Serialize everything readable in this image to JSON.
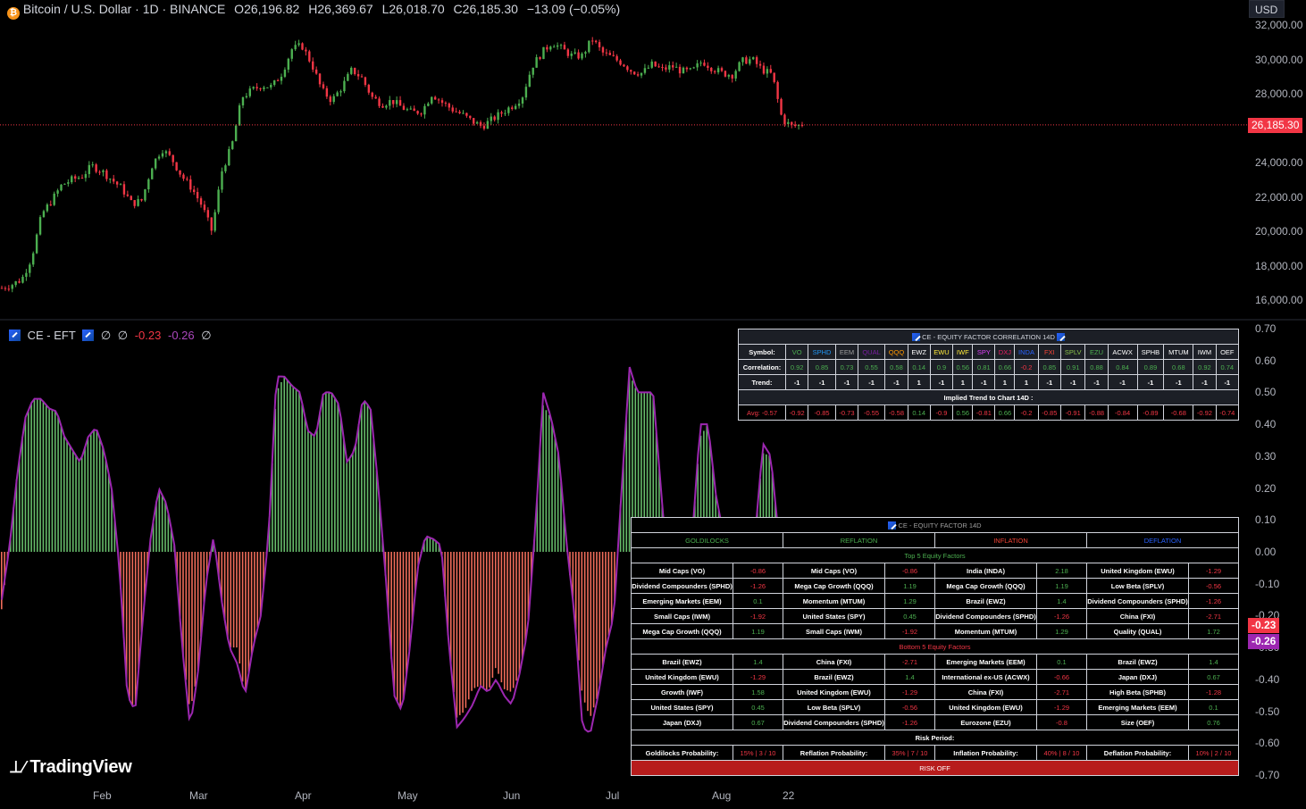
{
  "header": {
    "symbol": "Bitcoin / U.S. Dollar · 1D · BINANCE",
    "o_label": "O",
    "o_value": "26,196.82",
    "h_label": "H",
    "h_value": "26,369.67",
    "l_label": "L",
    "l_value": "26,018.70",
    "c_label": "C",
    "c_value": "26,185.30",
    "change": "−13.09 (−0.05%)"
  },
  "currency_button": "USD",
  "price_axis": [
    "32,000.00",
    "30,000.00",
    "28,000.00",
    "26,185.30",
    "24,000.00",
    "22,000.00",
    "20,000.00",
    "18,000.00",
    "16,000.00"
  ],
  "price_axis_values": [
    32000,
    30000,
    28000,
    26185.3,
    24000,
    22000,
    20000,
    18000,
    16000
  ],
  "last_price_tag": "26,185.30",
  "indicator": {
    "name": "CE - EFT",
    "v1": "∅",
    "v2": "∅",
    "v3": "-0.23",
    "v4": "-0.26",
    "v5": "∅",
    "tag_red": "-0.23",
    "tag_purple": "-0.26"
  },
  "osc_axis": [
    "0.70",
    "0.60",
    "0.50",
    "0.40",
    "0.30",
    "0.20",
    "0.10",
    "0.00",
    "-0.10",
    "-0.20",
    "-0.30",
    "-0.40",
    "-0.50",
    "-0.60",
    "-0.70"
  ],
  "osc_axis_values": [
    0.7,
    0.6,
    0.5,
    0.4,
    0.3,
    0.2,
    0.1,
    0,
    -0.1,
    -0.2,
    -0.3,
    -0.4,
    -0.5,
    -0.6,
    -0.7
  ],
  "x_axis": [
    "Feb",
    "Mar",
    "Apr",
    "May",
    "Jun",
    "Jul",
    "Aug",
    "22"
  ],
  "brand": "TradingView",
  "colors": {
    "up": "#4caf50",
    "down": "#f23645",
    "oscUp": "#66bb6a",
    "oscDown": "#ef6c5a",
    "line": "#9c27b0",
    "lastPrice": "#f23645"
  },
  "corr_table": {
    "title": "CE - EQUITY FACTOR CORRELATION 14D",
    "symbol_label": "Symbol:",
    "symbols": [
      "VO",
      "SPHD",
      "EEM",
      "QUAL",
      "QQQ",
      "EWZ",
      "EWU",
      "IWF",
      "SPY",
      "DXJ",
      "INDA",
      "FXI",
      "SPLV",
      "EZU",
      "ACWX",
      "SPHB",
      "MTUM",
      "IWM",
      "OEF"
    ],
    "symbol_colors": [
      "#4caf50",
      "#2196f3",
      "#9e9e9e",
      "#7b1fa2",
      "#ff9800",
      "#ffffff",
      "#ffeb3b",
      "#ffeb3b",
      "#e040fb",
      "#e91e63",
      "#2962ff",
      "#f44336",
      "#8bc34a",
      "#4caf50",
      "#ffffff",
      "#ffffff",
      "#ffffff",
      "#ffffff",
      "#ffffff"
    ],
    "corr_label": "Correlation:",
    "correlations": [
      "0.92",
      "0.85",
      "0.73",
      "0.55",
      "0.58",
      "0.14",
      "0.9",
      "0.56",
      "0.81",
      "0.66",
      "-0.2",
      "0.85",
      "0.91",
      "0.88",
      "0.84",
      "0.89",
      "0.68",
      "0.92",
      "0.74"
    ],
    "trend_label": "Trend:",
    "trends": [
      "-1",
      "-1",
      "-1",
      "-1",
      "-1",
      "1",
      "-1",
      "1",
      "-1",
      "1",
      "1",
      "-1",
      "-1",
      "-1",
      "-1",
      "-1",
      "-1",
      "-1",
      "-1"
    ],
    "implied_label": "Implied Trend to Chart 14D :",
    "avg_label": "Avg: -0.57",
    "implied": [
      "-0.92",
      "-0.85",
      "-0.73",
      "-0.55",
      "-0.58",
      "0.14",
      "-0.9",
      "0.56",
      "-0.81",
      "0.66",
      "-0.2",
      "-0.85",
      "-0.91",
      "-0.88",
      "-0.84",
      "-0.89",
      "-0.68",
      "-0.92",
      "-0.74"
    ]
  },
  "eq_table": {
    "title": "CE - EQUITY FACTOR 14D",
    "regimes": [
      "GOLDILOCKS",
      "REFLATION",
      "INFLATION",
      "DEFLATION"
    ],
    "regime_colors": [
      "#4caf50",
      "#4caf50",
      "#f44336",
      "#2962ff"
    ],
    "top_label": "Top 5 Equity Factors",
    "top": [
      [
        [
          "Mid Caps (VO)",
          "-0.86"
        ],
        [
          "Mid Caps (VO)",
          "-0.86"
        ],
        [
          "India (INDA)",
          "2.18"
        ],
        [
          "United Kingdom (EWU)",
          "-1.29"
        ]
      ],
      [
        [
          "Dividend Compounders (SPHD)",
          "-1.26"
        ],
        [
          "Mega Cap Growth (QQQ)",
          "1.19"
        ],
        [
          "Mega Cap Growth (QQQ)",
          "1.19"
        ],
        [
          "Low Beta (SPLV)",
          "-0.56"
        ]
      ],
      [
        [
          "Emerging Markets (EEM)",
          "0.1"
        ],
        [
          "Momentum (MTUM)",
          "1.29"
        ],
        [
          "Brazil (EWZ)",
          "1.4"
        ],
        [
          "Dividend Compounders (SPHD)",
          "-1.26"
        ]
      ],
      [
        [
          "Small Caps (IWM)",
          "-1.92"
        ],
        [
          "United States (SPY)",
          "0.45"
        ],
        [
          "Dividend Compounders (SPHD)",
          "-1.26"
        ],
        [
          "China (FXI)",
          "-2.71"
        ]
      ],
      [
        [
          "Mega Cap Growth (QQQ)",
          "1.19"
        ],
        [
          "Small Caps (IWM)",
          "-1.92"
        ],
        [
          "Momentum (MTUM)",
          "1.29"
        ],
        [
          "Quality (QUAL)",
          "1.72"
        ]
      ]
    ],
    "bottom_label": "Bottom 5 Equity Factors",
    "bottom": [
      [
        [
          "Brazil (EWZ)",
          "1.4"
        ],
        [
          "China (FXI)",
          "-2.71"
        ],
        [
          "Emerging Markets (EEM)",
          "0.1"
        ],
        [
          "Brazil (EWZ)",
          "1.4"
        ]
      ],
      [
        [
          "United Kingdom (EWU)",
          "-1.29"
        ],
        [
          "Brazil (EWZ)",
          "1.4"
        ],
        [
          "International ex-US (ACWX)",
          "-0.66"
        ],
        [
          "Japan (DXJ)",
          "0.67"
        ]
      ],
      [
        [
          "Growth (IWF)",
          "1.58"
        ],
        [
          "United Kingdom (EWU)",
          "-1.29"
        ],
        [
          "China (FXI)",
          "-2.71"
        ],
        [
          "High Beta (SPHB)",
          "-1.28"
        ]
      ],
      [
        [
          "United States (SPY)",
          "0.45"
        ],
        [
          "Low Beta (SPLV)",
          "-0.56"
        ],
        [
          "United Kingdom (EWU)",
          "-1.29"
        ],
        [
          "Emerging Markets (EEM)",
          "0.1"
        ]
      ],
      [
        [
          "Japan (DXJ)",
          "0.67"
        ],
        [
          "Dividend Compounders (SPHD)",
          "-1.26"
        ],
        [
          "Eurozone (EZU)",
          "-0.8"
        ],
        [
          "Size (OEF)",
          "0.76"
        ]
      ]
    ],
    "risk_label": "Risk Period:",
    "probs": [
      [
        "Goldilocks Probability:",
        "15% | 3 / 10"
      ],
      [
        "Reflation Probability:",
        "35% | 7 / 10"
      ],
      [
        "Inflation Probability:",
        "40% | 8 / 10"
      ],
      [
        "Deflation Probability:",
        "10% | 2 / 10"
      ]
    ],
    "risk_off": "RISK OFF"
  },
  "chart_data": [
    {
      "type": "candlestick",
      "title": "Bitcoin / U.S. Dollar · 1D · BINANCE",
      "ylim": [
        15500,
        32500
      ],
      "x": [
        "Feb",
        "Mar",
        "Apr",
        "May",
        "Jun",
        "Jul",
        "Aug",
        "22"
      ],
      "close_path": [
        16700,
        16900,
        17200,
        18500,
        21000,
        21800,
        22700,
        23000,
        23200,
        23800,
        23500,
        23000,
        22500,
        21600,
        21800,
        23800,
        24800,
        24200,
        23200,
        22500,
        21500,
        20000,
        23500,
        25000,
        27800,
        28200,
        28500,
        28400,
        29200,
        30600,
        30800,
        29700,
        28200,
        27600,
        28400,
        29400,
        28900,
        27800,
        27400,
        27600,
        27200,
        26900,
        27000,
        28000,
        27500,
        27100,
        26800,
        26400,
        26100,
        26500,
        26900,
        27300,
        27800,
        29600,
        30400,
        31000,
        30600,
        30200,
        30200,
        31200,
        30400,
        30100,
        29800,
        29300,
        29200,
        29700,
        29400,
        29600,
        29300,
        29300,
        29900,
        29500,
        29200,
        29100,
        29900,
        30000,
        29400,
        29100,
        26500,
        26100,
        26185.3
      ],
      "last": 26185.3
    },
    {
      "type": "bar",
      "title": "CE - EFT",
      "ylim": [
        -0.7,
        0.7
      ],
      "values": [
        -0.18,
        0.02,
        0.25,
        0.42,
        0.48,
        0.48,
        0.45,
        0.44,
        0.36,
        0.32,
        0.28,
        0.36,
        0.39,
        0.32,
        0.2,
        -0.05,
        -0.45,
        -0.5,
        -0.2,
        0.05,
        0.2,
        0.15,
        0.02,
        -0.3,
        -0.5,
        -0.38,
        -0.1,
        0.05,
        -0.15,
        -0.3,
        -0.3,
        -0.45,
        -0.3,
        -0.2,
        0.05,
        0.5,
        0.55,
        0.52,
        0.5,
        0.38,
        0.36,
        0.5,
        0.5,
        0.46,
        0.28,
        0.32,
        0.48,
        0.45,
        0.2,
        -0.1,
        -0.45,
        -0.5,
        -0.3,
        -0.05,
        0.05,
        0.04,
        0.02,
        -0.3,
        -0.52,
        -0.5,
        -0.43,
        -0.42,
        -0.44,
        -0.36,
        -0.43,
        -0.44,
        -0.38,
        -0.25,
        0.08,
        0.46,
        0.42,
        0.3,
        0.02,
        -0.2,
        -0.45,
        -0.52,
        -0.45,
        -0.3,
        -0.2,
        0.2,
        0.56,
        0.5,
        0.5,
        0.5,
        0.2,
        -0.1,
        -0.25,
        -0.2,
        0.05,
        0.36,
        0.4,
        0.18,
        0.05,
        -0.2,
        -0.3,
        -0.23,
        0.05,
        0.31,
        0.3,
        0.05,
        -0.4,
        -0.57,
        -0.23
      ],
      "line_values": [
        -0.15,
        0.02,
        0.25,
        0.42,
        0.48,
        0.48,
        0.45,
        0.44,
        0.36,
        0.32,
        0.28,
        0.36,
        0.39,
        0.32,
        0.2,
        -0.05,
        -0.45,
        -0.5,
        -0.2,
        0.05,
        0.2,
        0.15,
        0.02,
        -0.3,
        -0.55,
        -0.38,
        -0.1,
        0.05,
        -0.15,
        -0.3,
        -0.35,
        -0.45,
        -0.3,
        -0.2,
        0.05,
        0.55,
        0.55,
        0.52,
        0.5,
        0.38,
        0.36,
        0.5,
        0.5,
        0.46,
        0.28,
        0.32,
        0.48,
        0.45,
        0.2,
        -0.1,
        -0.45,
        -0.5,
        -0.3,
        -0.05,
        0.05,
        0.04,
        0.02,
        -0.3,
        -0.55,
        -0.52,
        -0.48,
        -0.42,
        -0.44,
        -0.4,
        -0.45,
        -0.48,
        -0.38,
        -0.25,
        0.08,
        0.5,
        0.42,
        0.3,
        0.02,
        -0.2,
        -0.55,
        -0.57,
        -0.45,
        -0.3,
        -0.2,
        0.2,
        0.58,
        0.5,
        0.5,
        0.5,
        0.2,
        -0.1,
        -0.25,
        -0.2,
        0.05,
        0.4,
        0.4,
        0.18,
        0.05,
        -0.2,
        -0.3,
        -0.23,
        0.05,
        0.34,
        0.3,
        0.05,
        -0.45,
        -0.6,
        -0.26
      ]
    }
  ]
}
